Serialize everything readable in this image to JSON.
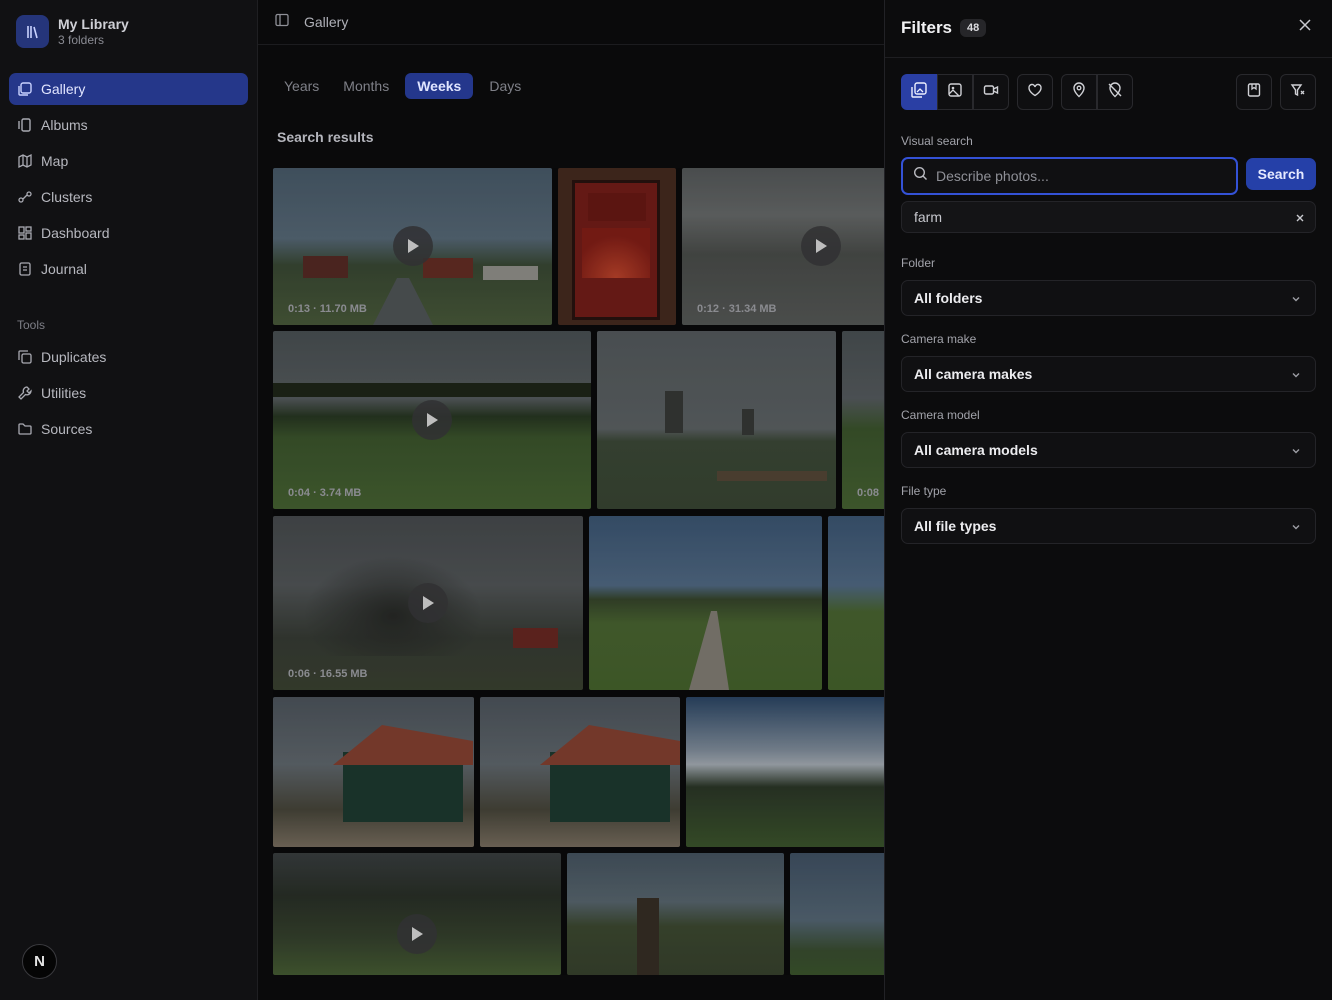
{
  "library": {
    "title": "My Library",
    "subtitle": "3 folders"
  },
  "nav": [
    {
      "label": "Gallery",
      "icon": "gallery-icon"
    },
    {
      "label": "Albums",
      "icon": "albums-icon"
    },
    {
      "label": "Map",
      "icon": "map-icon"
    },
    {
      "label": "Clusters",
      "icon": "clusters-icon"
    },
    {
      "label": "Dashboard",
      "icon": "dashboard-icon"
    },
    {
      "label": "Journal",
      "icon": "journal-icon"
    }
  ],
  "tools_label": "Tools",
  "tools": [
    {
      "label": "Duplicates",
      "icon": "duplicates-icon"
    },
    {
      "label": "Utilities",
      "icon": "wrench-icon"
    },
    {
      "label": "Sources",
      "icon": "folder-icon"
    }
  ],
  "avatar_letter": "N",
  "main": {
    "title": "Gallery",
    "tabs": [
      "Years",
      "Months",
      "Weeks",
      "Days"
    ],
    "active_tab": "Weeks",
    "results_title": "Search results",
    "tiles_meta": [
      "0:13 · 11.70 MB",
      "0:12 · 31.34 MB",
      "0:04 · 3.74 MB",
      "0:08",
      "0:06 · 16.55 MB"
    ]
  },
  "filters": {
    "title": "Filters",
    "count": "48",
    "visual_search_label": "Visual search",
    "search_placeholder": "Describe photos...",
    "search_button": "Search",
    "chip": "farm",
    "folder_label": "Folder",
    "folder_value": "All folders",
    "camera_make_label": "Camera make",
    "camera_make_value": "All camera makes",
    "camera_model_label": "Camera model",
    "camera_model_value": "All camera models",
    "file_type_label": "File type",
    "file_type_value": "All file types"
  },
  "colors": {
    "accent": "#2540a8",
    "active_nav": "#25378a"
  }
}
